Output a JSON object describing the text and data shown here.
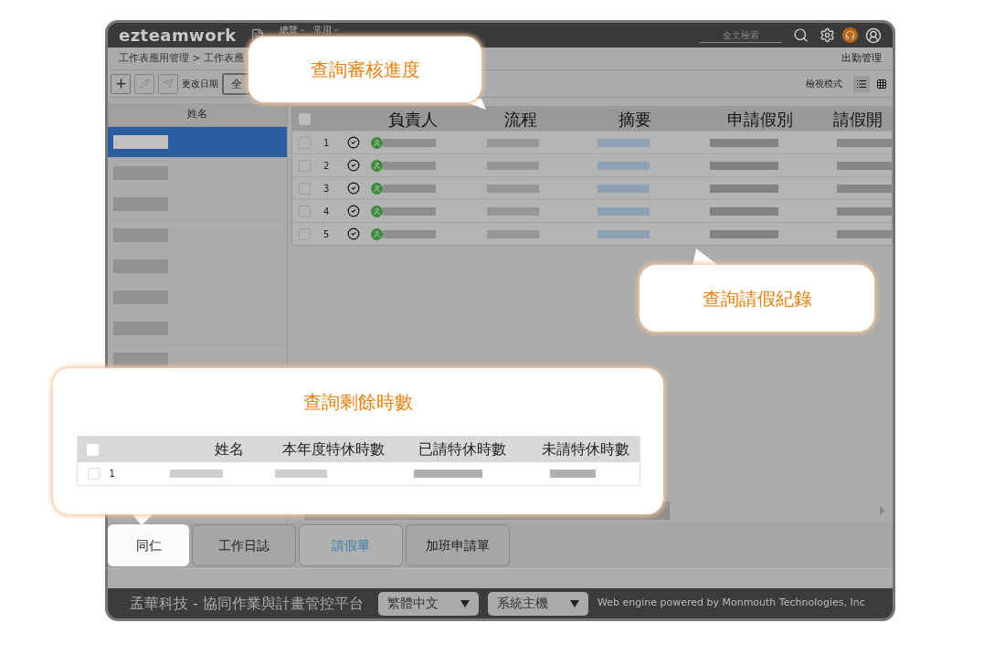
{
  "app": {
    "logo": "ezteamwork",
    "nav": [
      {
        "label": "總覽"
      },
      {
        "label": "常用"
      }
    ],
    "search": {
      "placeholder": "全文檢索"
    }
  },
  "breadcrumb": "工作表應用管理 > 工作表應",
  "module_title": "出勤管理",
  "toolbar": {
    "date_label": "更改日期",
    "date_button": "全",
    "view_label": "檢視模式",
    "view_modes": [
      {
        "kind": "list",
        "selected": true
      },
      {
        "kind": "grid",
        "selected": false
      }
    ]
  },
  "staff_list": {
    "header": "姓名",
    "rows": [
      {
        "selected": true
      },
      {
        "selected": false
      },
      {
        "selected": false
      },
      {
        "selected": false
      },
      {
        "selected": false
      },
      {
        "selected": false
      },
      {
        "selected": false
      },
      {
        "selected": false
      }
    ]
  },
  "grid": {
    "all_checked": false,
    "columns": [
      "負責人",
      "流程",
      "摘要",
      "申請假別",
      "請假開"
    ],
    "rows": [
      {
        "number": "1",
        "checked": false
      },
      {
        "number": "2",
        "checked": false
      },
      {
        "number": "3",
        "checked": false
      },
      {
        "number": "4",
        "checked": false
      },
      {
        "number": "5",
        "checked": false
      }
    ]
  },
  "tabs": [
    {
      "label": "同仁",
      "selected": false,
      "spotlight": true
    },
    {
      "label": "工作日誌",
      "selected": false,
      "spotlight": false
    },
    {
      "label": "請假單",
      "selected": true,
      "spotlight": false
    },
    {
      "label": "加班申請單",
      "selected": false,
      "spotlight": false
    }
  ],
  "footer": {
    "company": "孟華科技 - 協同作業與計畫管控平台",
    "language": "繁體中文",
    "server": "系統主機",
    "credit": "Web engine powered by Monmouth Technologies, Inc"
  },
  "callouts": [
    {
      "title": "查詢審核進度"
    },
    {
      "title": "查詢請假紀錄"
    },
    {
      "title": "查詢剩餘時數",
      "table": {
        "all_checked": false,
        "columns": [
          "姓名",
          "本年度特休時數",
          "已請特休時數",
          "未請特休時數"
        ],
        "rows": [
          {
            "number": "1",
            "checked": false
          }
        ]
      }
    }
  ]
}
